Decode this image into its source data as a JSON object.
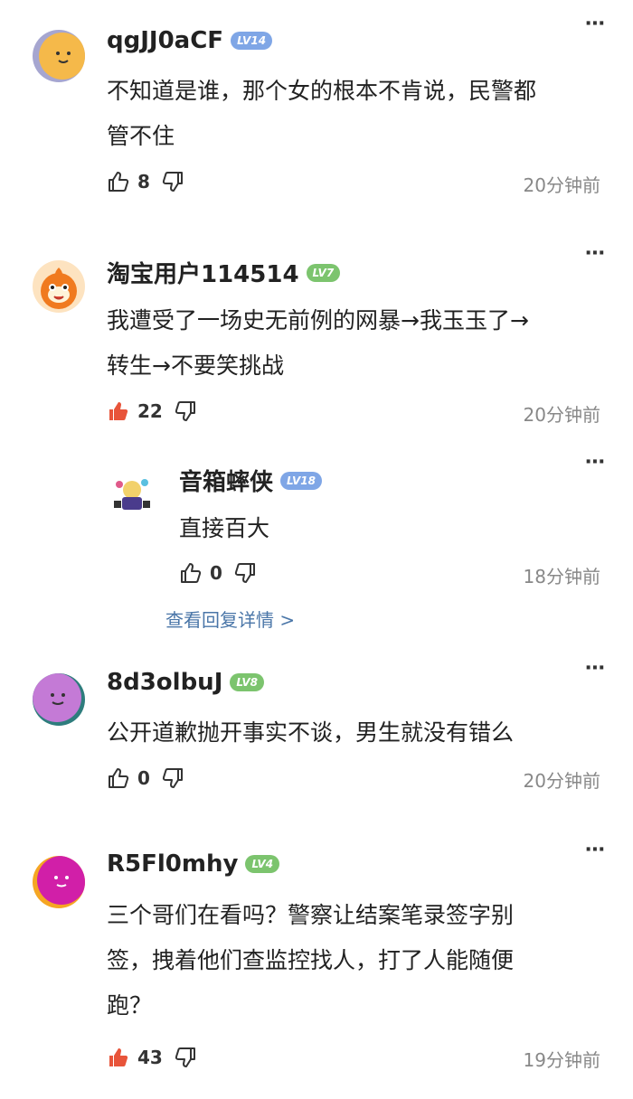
{
  "comments": [
    {
      "username": "qgJJ0aCF",
      "level": "LV14",
      "text_lines": [
        "不知道是谁，那个女的根本不肯说，民警都",
        "管不住"
      ],
      "likes": "8",
      "time": "20分钟前",
      "liked": false
    },
    {
      "username": "淘宝用户114514",
      "level": "LV7",
      "text_lines": [
        "我遭受了一场史无前例的网暴→我玉玉了→",
        "转生→不要笑挑战"
      ],
      "likes": "22",
      "time": "20分钟前",
      "liked": true
    },
    {
      "username": "8d3olbuJ",
      "level": "LV8",
      "text_lines": [
        "公开道歉抛开事实不谈，男生就没有错么"
      ],
      "likes": "0",
      "time": "20分钟前",
      "liked": false
    },
    {
      "username": "R5Fl0mhy",
      "level": "LV4",
      "text_lines": [
        "三个哥们在看吗？警察让结案笔录签字别",
        "签，拽着他们查监控找人，打了人能随便",
        "跑？"
      ],
      "likes": "43",
      "time": "19分钟前",
      "liked": true
    }
  ],
  "reply": {
    "username": "音箱蟀侠",
    "level": "LV18",
    "text": "直接百大",
    "likes": "0",
    "time": "18分钟前",
    "liked": false
  },
  "reply_link": "查看回复详情 >",
  "more_icon": "⋯",
  "colors": {
    "lv_blue": "#7fa6e6",
    "lv_green": "#7cc46e",
    "liked": "#e8543a"
  }
}
